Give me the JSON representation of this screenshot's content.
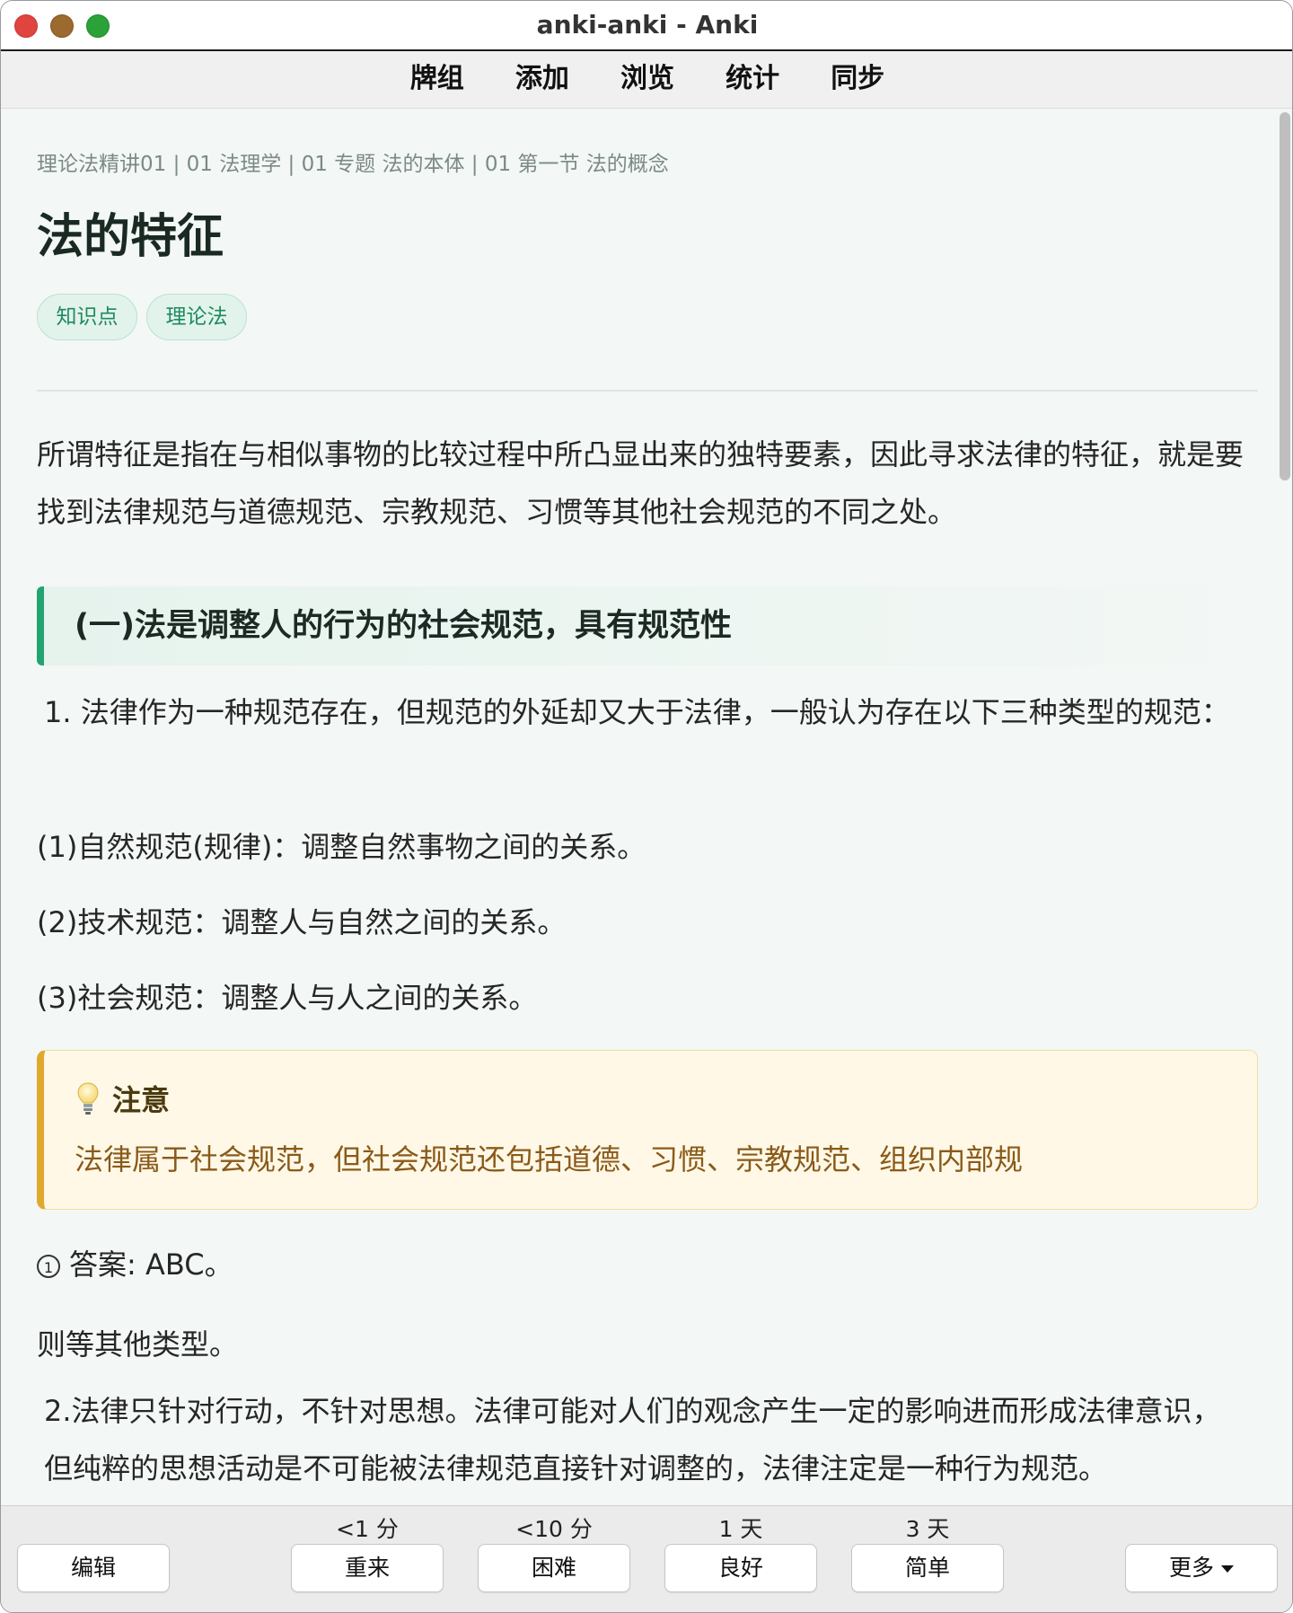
{
  "window": {
    "title": "anki-anki - Anki"
  },
  "toolbar": {
    "items": [
      "牌组",
      "添加",
      "浏览",
      "统计",
      "同步"
    ]
  },
  "card": {
    "breadcrumb": "理论法精讲01 | 01 法理学 | 01 专题 法的本体 | 01 第一节 法的概念",
    "heading": "法的特征",
    "tags": [
      "知识点",
      "理论法"
    ],
    "intro": "所谓特征是指在与相似事物的比较过程中所凸显出来的独特要素，因此寻求法律的特征，就是要找到法律规范与道德规范、宗教规范、习惯等其他社会规范的不同之处。",
    "section_title": "(一)法是调整人的行为的社会规范，具有规范性",
    "p1": "1. 法律作为一种规范存在，但规范的外延却又大于法律，一般认为存在以下三种类型的规范：",
    "p2": "(1)自然规范(规律)：调整自然事物之间的关系。",
    "p3": "(2)技术规范：调整人与自然之间的关系。",
    "p4": "(3)社会规范：调整人与人之间的关系。",
    "note": {
      "icon": "lightbulb-icon",
      "title": "注意",
      "body": "法律属于社会规范，但社会规范还包括道德、习惯、宗教规范、组织内部规"
    },
    "answer": {
      "marker": "1",
      "text": "答案: ABC。"
    },
    "p5": "则等其他类型。",
    "p6": "2.法律只针对行动，不针对思想。法律可能对人们的观念产生一定的影响进而形成法律意识，但纯粹的思想活动是不可能被法律规范直接针对调整的，法律注定是一种行为规范。"
  },
  "bottom": {
    "edit": "编辑",
    "ease_buttons": [
      {
        "time": "<1 分",
        "label": "重来"
      },
      {
        "time": "<10 分",
        "label": "困难"
      },
      {
        "time": "1 天",
        "label": "良好"
      },
      {
        "time": "3 天",
        "label": "简单"
      }
    ],
    "more": "更多"
  },
  "colors": {
    "accent": "#22a372",
    "note_border": "#e0a92e",
    "tag_text": "#1f8a5e"
  }
}
